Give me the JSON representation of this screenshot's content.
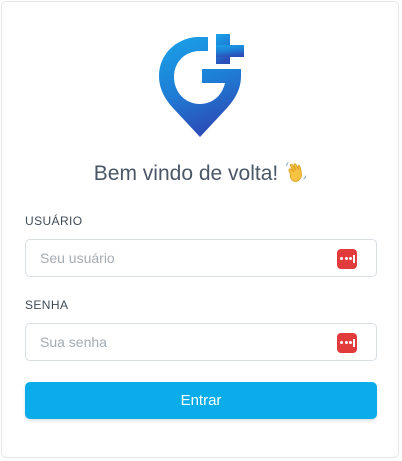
{
  "login": {
    "welcome_text": "Bem vindo de volta!",
    "wave_icon": "waving-hand-icon",
    "username": {
      "label": "USUÁRIO",
      "placeholder": "Seu usuário",
      "value": ""
    },
    "password": {
      "label": "SENHA",
      "placeholder": "Sua senha",
      "value": ""
    },
    "submit_label": "Entrar"
  },
  "icons": {
    "logo": "brand-logo-pin-icon",
    "password_manager": "password-manager-icon"
  },
  "colors": {
    "brand_gradient_top": "#1aa3e8",
    "brand_gradient_bottom": "#2b4fb8",
    "button": "#0bacea",
    "password_manager": "#e23b3b",
    "heading_text": "#4a5766"
  }
}
